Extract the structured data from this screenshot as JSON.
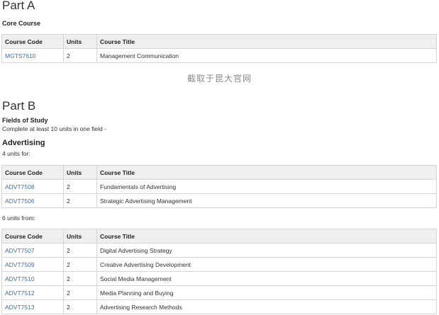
{
  "part_a": {
    "title": "Part A",
    "section_label": "Core Course",
    "table": {
      "headers": [
        "Course Code",
        "Units",
        "Course Title"
      ],
      "rows": [
        {
          "code": "MGTS7610",
          "units": "2",
          "title": "Management Communication"
        }
      ]
    }
  },
  "watermark": "截取于昆大官网",
  "part_b": {
    "title": "Part B",
    "section_label": "Fields of Study",
    "instruction": "Complete at least 10 units in one field -",
    "field": {
      "title": "Advertising",
      "group1": {
        "note": "4 units for:",
        "headers": [
          "Course Code",
          "Units",
          "Course Title"
        ],
        "rows": [
          {
            "code": "ADVT7508",
            "units": "2",
            "title": "Fundamentals of Advertising"
          },
          {
            "code": "ADVT7506",
            "units": "2",
            "title": "Strategic Advertising Management"
          }
        ]
      },
      "group2": {
        "note": "6 units from:",
        "headers": [
          "Course Code",
          "Units",
          "Course Title"
        ],
        "rows": [
          {
            "code": "ADVT7507",
            "units": "2",
            "title": "Digital Advertising Strategy"
          },
          {
            "code": "ADVT7509",
            "units": "2",
            "title": "Creative Advertising Development"
          },
          {
            "code": "ADVT7510",
            "units": "2",
            "title": "Social Media Management"
          },
          {
            "code": "ADVT7512",
            "units": "2",
            "title": "Media Planning and Buying"
          },
          {
            "code": "ADVT7513",
            "units": "2",
            "title": "Advertising Research Methods"
          }
        ]
      }
    }
  },
  "colors": {
    "link": "#3a6fb5",
    "header_bg": "#efefef",
    "border": "#d6d6d6"
  }
}
